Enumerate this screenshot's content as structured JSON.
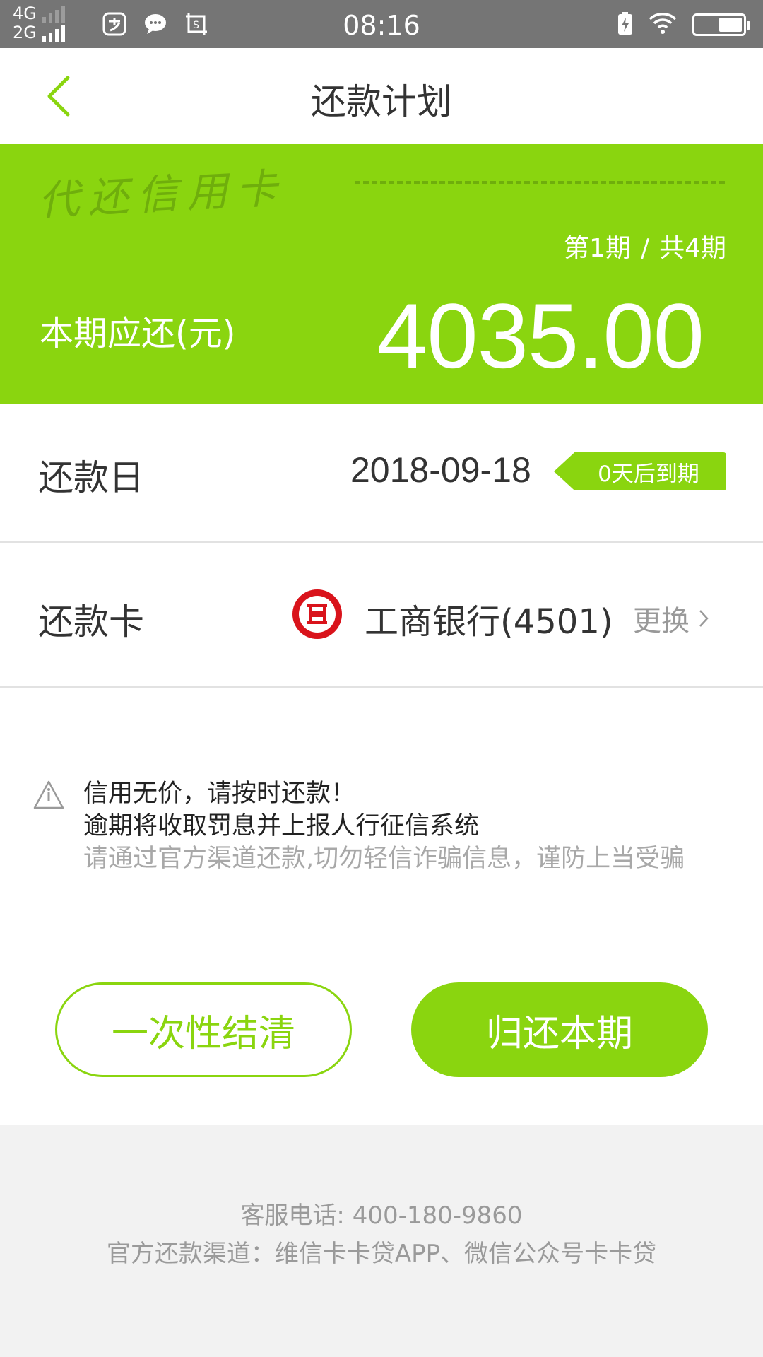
{
  "status_bar": {
    "network_top": "4G",
    "network_bottom": "2G",
    "time": "08:16",
    "apps": [
      "alipay-icon",
      "message-icon",
      "screenshot-icon"
    ],
    "right_icons": [
      "charging-icon",
      "wifi-icon",
      "battery-icon"
    ]
  },
  "nav": {
    "title": "还款计划",
    "back_icon": "back-arrow-icon"
  },
  "banner": {
    "brand": "代还信用卡",
    "period_current": "第1期",
    "period_sep": "/",
    "period_total": "共4期",
    "due_label": "本期应还(元)",
    "due_amount": "4035.00"
  },
  "repay_date": {
    "label": "还款日",
    "value": "2018-09-18",
    "badge": "0天后到期"
  },
  "repay_card": {
    "label": "还款卡",
    "bank": "工商银行(4501)",
    "change": "更换",
    "bank_icon": "icbc-logo-icon"
  },
  "notice": {
    "line1": "信用无价，请按时还款！",
    "line2": "逾期将收取罚息并上报人行征信系统",
    "line3": "请通过官方渠道还款,切勿轻信诈骗信息，谨防上当受骗"
  },
  "buttons": {
    "settle_all": "一次性结清",
    "repay_current": "归还本期"
  },
  "footer": {
    "service_phone": "客服电话: 400-180-9860",
    "channels": "官方还款渠道：维信卡卡贷APP、微信公众号卡卡贷"
  },
  "colors": {
    "accent": "#8ad50f",
    "status_bar": "#757575",
    "bank_red": "#d9131b",
    "footer_bg": "#f2f2f2"
  }
}
